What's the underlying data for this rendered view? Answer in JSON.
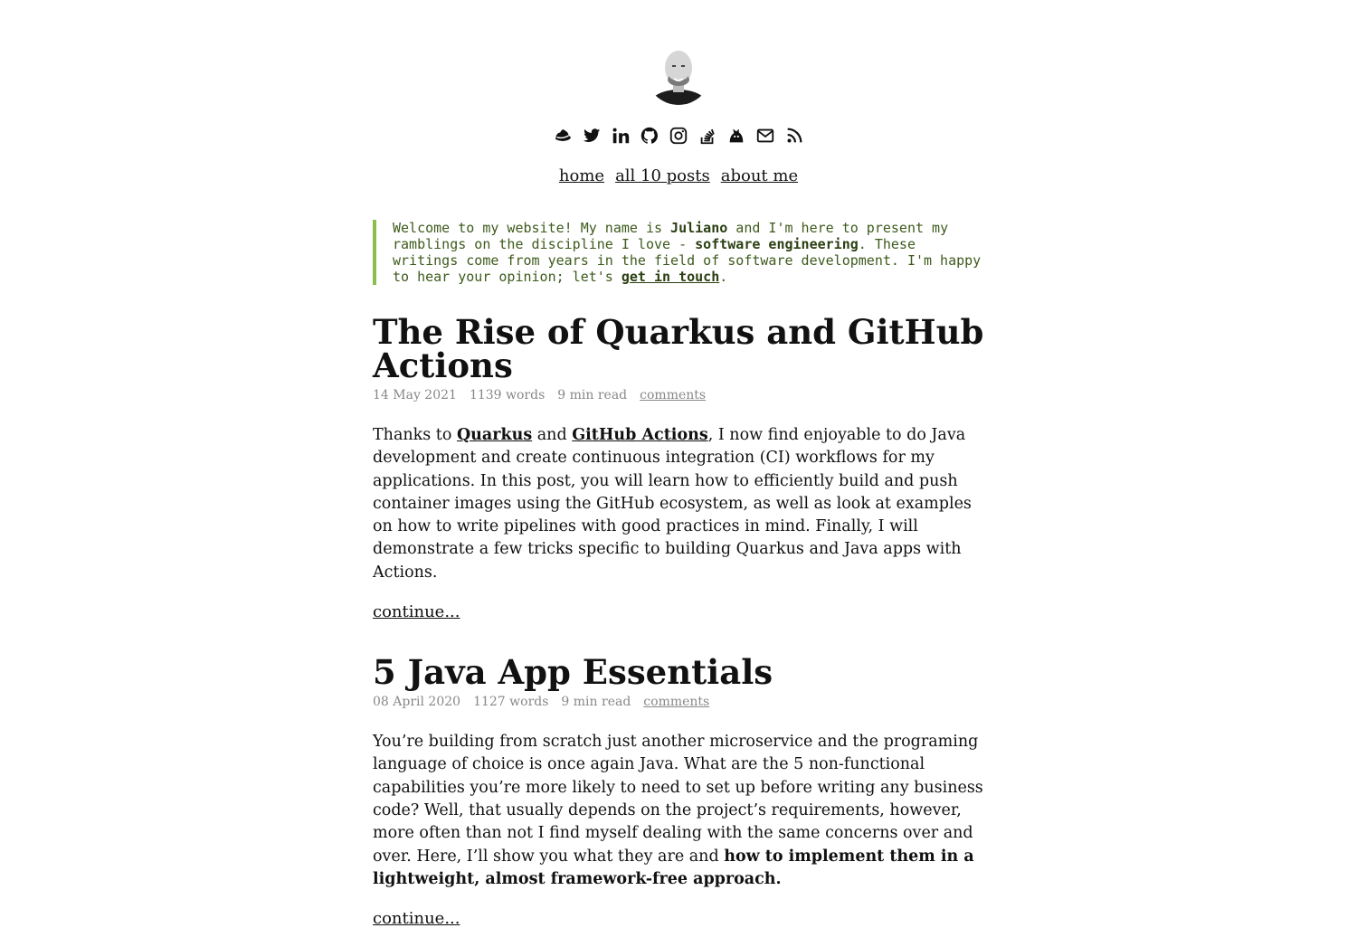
{
  "avatar": {
    "alt": "Juliano"
  },
  "social_icons": [
    "redhat-icon",
    "twitter-icon",
    "linkedin-icon",
    "github-icon",
    "instagram-icon",
    "stackoverflow-icon",
    "mastodon-icon",
    "email-icon",
    "rss-icon"
  ],
  "nav": {
    "home": "home",
    "posts": "all 10 posts",
    "about": "about me"
  },
  "intro": {
    "part1": "Welcome to my website! My name is ",
    "name": "Juliano",
    "part2": " and I'm here to present my ramblings on the discipline I love - ",
    "topic": "software engineering",
    "part3": ". These writings come from years in the field of software development. I'm happy to hear your opinion; let's ",
    "contact_link": "get in touch",
    "part4": "."
  },
  "posts": [
    {
      "title": "The Rise of Quarkus and GitHub Actions",
      "date": "14 May 2021",
      "words": "1139 words",
      "read_time": "9 min read",
      "comments": "comments",
      "summary": {
        "t1": "Thanks to ",
        "link1": "Quarkus",
        "t2": " and ",
        "link2": "GitHub Actions",
        "t3": ", I now find enjoyable to do Java development and create continuous integration (CI) workflows for my applications. In this post, you will learn how to efficiently build and push container images using the GitHub ecosystem, as well as look at examples on how to write pipelines with good practices in mind. Finally, I will demonstrate a few tricks specific to building Quarkus and Java apps with Actions."
      },
      "continue": "continue..."
    },
    {
      "title": "5 Java App Essentials",
      "date": "08 April 2020",
      "words": "1127 words",
      "read_time": "9 min read",
      "comments": "comments",
      "summary": {
        "t1": "You’re building from scratch just another microservice and the programing language of choice is once again Java. What are the 5 non-functional capabilities you’re more likely to need to set up before writing any business code? Well, that usually depends on the project’s requirements, however, more often than not I find myself dealing with the same concerns over and over. Here, I’ll show you what they are and ",
        "bold": "how to implement them in a lightweight, almost framework-free approach."
      },
      "continue": "continue..."
    }
  ],
  "colors": {
    "accent_border": "#8bbd4f",
    "intro_text": "#3d5a1c",
    "meta_text": "#888888"
  }
}
